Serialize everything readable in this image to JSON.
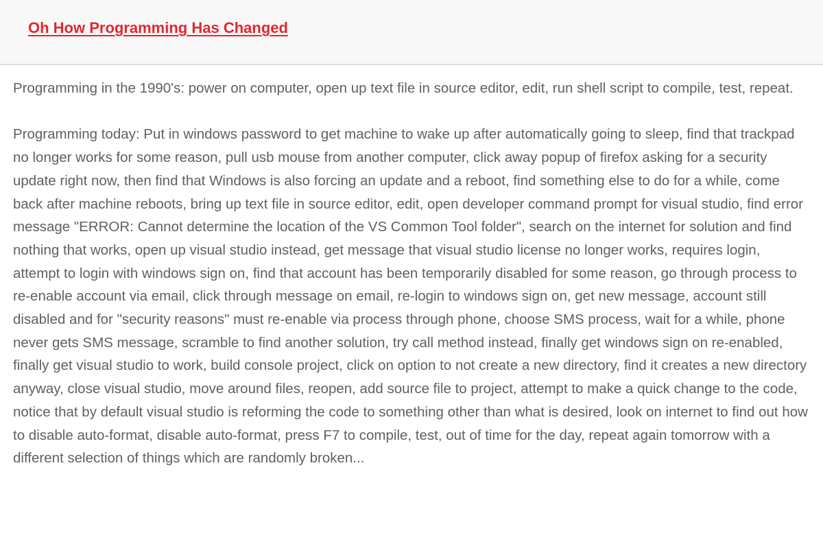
{
  "post": {
    "title": "Oh How Programming Has Changed",
    "paragraphs": [
      "Programming in the 1990's: power on computer, open up text file in source editor, edit, run shell script to compile, test, repeat.",
      "Programming today: Put in windows password to get machine to wake up after automatically going to sleep, find that trackpad no longer works for some reason, pull usb mouse from another computer, click away popup of firefox asking for a security update right now, then find that Windows is also forcing an update and a reboot, find something else to do for a while, come back after machine reboots, bring up text file in source editor, edit, open developer command prompt for visual studio, find error message \"ERROR: Cannot determine the location of the VS Common Tool folder\", search on the internet for solution and find nothing that works, open up visual studio instead, get message that visual studio license no longer works, requires login, attempt to login with windows sign on, find that account has been temporarily disabled for some reason, go through process to re-enable account via email, click through message on email, re-login to windows sign on, get new message, account still disabled and for \"security reasons\" must re-enable via process through phone, choose SMS process, wait for a while, phone never gets SMS message, scramble to find another solution, try call method instead, finally get windows sign on re-enabled, finally get visual studio to work, build console project, click on option to not create a new directory, find it creates a new directory anyway, close visual studio, move around files, reopen, add source file to project, attempt to make a quick change to the code, notice that by default visual studio is reforming the code to something other than what is desired, look on internet to find out how to disable auto-format, disable auto-format, press F7 to compile, test, out of time for the day, repeat again tomorrow with a different selection of things which are randomly broken..."
    ]
  },
  "colors": {
    "title": "#e0282e",
    "body_text": "#606060",
    "header_background": "#f8f8f8",
    "header_border": "#dcdcdc"
  }
}
